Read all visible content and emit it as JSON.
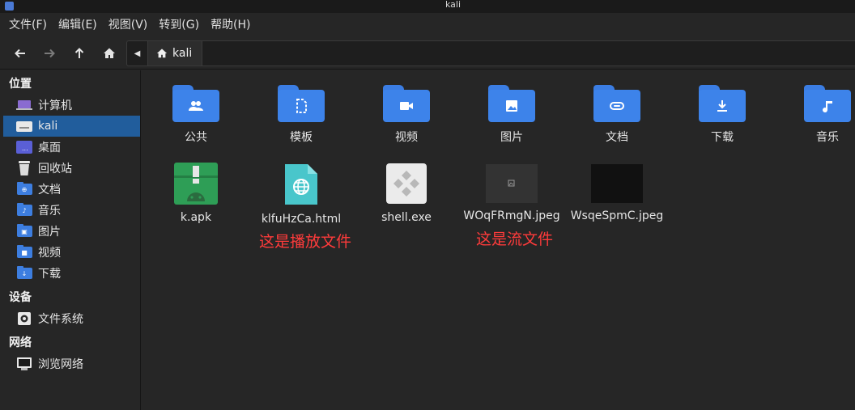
{
  "window": {
    "title": "kali"
  },
  "menu": [
    "文件(F)",
    "编辑(E)",
    "视图(V)",
    "转到(G)",
    "帮助(H)"
  ],
  "path": {
    "current": "kali"
  },
  "sidebar": {
    "places_header": "位置",
    "places": [
      {
        "label": "计算机",
        "icon": "computer-icon"
      },
      {
        "label": "kali",
        "icon": "home-folder-icon",
        "selected": true
      },
      {
        "label": "桌面",
        "icon": "desktop-icon"
      },
      {
        "label": "回收站",
        "icon": "trash-icon"
      },
      {
        "label": "文档",
        "icon": "documents-folder-icon"
      },
      {
        "label": "音乐",
        "icon": "music-folder-icon"
      },
      {
        "label": "图片",
        "icon": "pictures-folder-icon"
      },
      {
        "label": "视频",
        "icon": "videos-folder-icon"
      },
      {
        "label": "下载",
        "icon": "downloads-folder-icon"
      }
    ],
    "devices_header": "设备",
    "devices": [
      {
        "label": "文件系统",
        "icon": "drive-icon"
      }
    ],
    "network_header": "网络",
    "network": [
      {
        "label": "浏览网络",
        "icon": "network-icon"
      }
    ]
  },
  "folders": [
    {
      "label": "公共",
      "icon": "public-folder-icon"
    },
    {
      "label": "模板",
      "icon": "templates-folder-icon"
    },
    {
      "label": "视频",
      "icon": "videos-folder-icon"
    },
    {
      "label": "图片",
      "icon": "pictures-folder-icon"
    },
    {
      "label": "文档",
      "icon": "documents-folder-icon"
    },
    {
      "label": "下载",
      "icon": "downloads-folder-icon"
    },
    {
      "label": "音乐",
      "icon": "music-folder-icon"
    }
  ],
  "files": [
    {
      "label": "k.apk",
      "icon": "android-package-icon"
    },
    {
      "label": "klfuHzCa.html",
      "icon": "html-file-icon"
    },
    {
      "label": "shell.exe",
      "icon": "exe-file-icon"
    },
    {
      "label": "WOqFRmgN.jpeg",
      "icon": "image-thumbnail-icon"
    },
    {
      "label": "WsqeSpmC.jpeg",
      "icon": "image-thumbnail-icon"
    }
  ],
  "annotations": {
    "html_note": "这是播放文件",
    "jpeg_note": "这是流文件"
  },
  "colors": {
    "folder": "#3d83ea",
    "selection": "#215d9c",
    "annotation": "#ff3b3b",
    "apk": "#2e9e56",
    "html": "#49c6cb"
  }
}
